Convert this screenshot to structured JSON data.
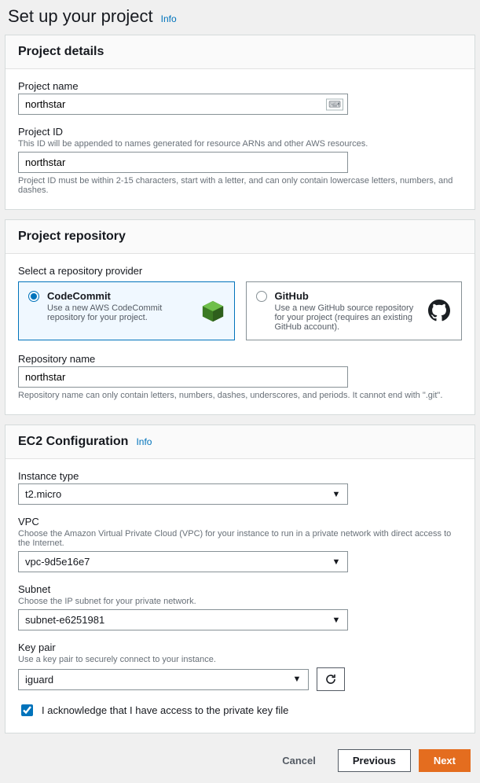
{
  "header": {
    "title": "Set up your project",
    "info": "Info"
  },
  "projectDetails": {
    "title": "Project details",
    "name": {
      "label": "Project name",
      "value": "northstar"
    },
    "id": {
      "label": "Project ID",
      "help": "This ID will be appended to names generated for resource ARNs and other AWS resources.",
      "value": "northstar",
      "after": "Project ID must be within 2-15 characters, start with a letter, and can only contain lowercase letters, numbers, and dashes."
    }
  },
  "repo": {
    "title": "Project repository",
    "selectLabel": "Select a repository provider",
    "codecommit": {
      "title": "CodeCommit",
      "desc": "Use a new AWS CodeCommit repository for your project."
    },
    "github": {
      "title": "GitHub",
      "desc": "Use a new GitHub source repository for your project (requires an existing GitHub account)."
    },
    "name": {
      "label": "Repository name",
      "value": "northstar",
      "after": "Repository name can only contain letters, numbers, dashes, underscores, and periods. It cannot end with \".git\"."
    }
  },
  "ec2": {
    "title": "EC2 Configuration",
    "info": "Info",
    "instanceType": {
      "label": "Instance type",
      "value": "t2.micro"
    },
    "vpc": {
      "label": "VPC",
      "help": "Choose the Amazon Virtual Private Cloud (VPC) for your instance to run in a private network with direct access to the Internet.",
      "value": "vpc-9d5e16e7"
    },
    "subnet": {
      "label": "Subnet",
      "help": "Choose the IP subnet for your private network.",
      "value": "subnet-e6251981"
    },
    "keypair": {
      "label": "Key pair",
      "help": "Use a key pair to securely connect to your instance.",
      "value": "iguard"
    },
    "ack": "I acknowledge that I have access to the private key file"
  },
  "footer": {
    "cancel": "Cancel",
    "previous": "Previous",
    "next": "Next"
  }
}
